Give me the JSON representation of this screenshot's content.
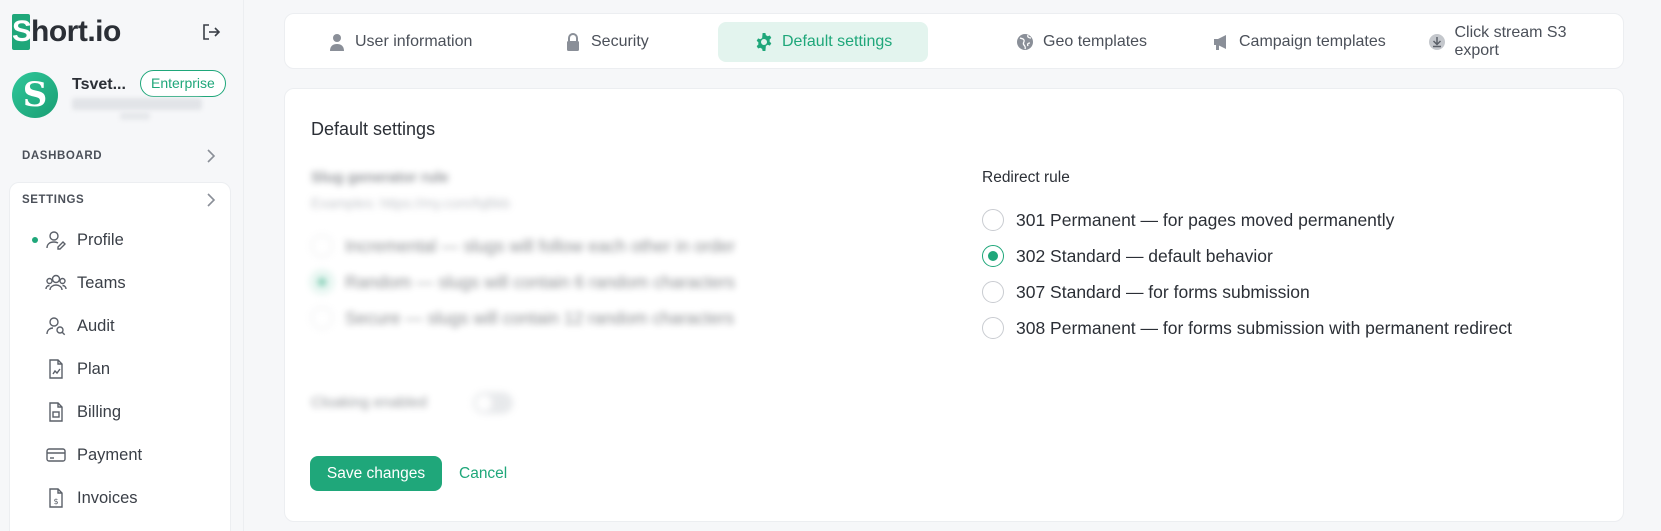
{
  "brand": {
    "logo_text": "hort.io",
    "logo_mark": "S"
  },
  "user": {
    "name": "Tsvet...",
    "plan": "Enterprise",
    "avatar_letter": "S"
  },
  "sidebar": {
    "dashboard_label": "DASHBOARD",
    "settings_label": "SETTINGS",
    "items": [
      {
        "label": "Profile",
        "icon": "user-edit-icon",
        "active": true
      },
      {
        "label": "Teams",
        "icon": "team-icon"
      },
      {
        "label": "Audit",
        "icon": "audit-icon"
      },
      {
        "label": "Plan",
        "icon": "plan-icon"
      },
      {
        "label": "Billing",
        "icon": "billing-icon"
      },
      {
        "label": "Payment",
        "icon": "card-icon"
      },
      {
        "label": "Invoices",
        "icon": "invoice-icon"
      }
    ]
  },
  "tabs": [
    {
      "label": "User information",
      "icon": "user-icon"
    },
    {
      "label": "Security",
      "icon": "lock-icon"
    },
    {
      "label": "Default settings",
      "icon": "gear-icon",
      "active": true
    },
    {
      "label": "Geo templates",
      "icon": "globe-icon"
    },
    {
      "label": "Campaign templates",
      "icon": "megaphone-icon"
    },
    {
      "label": "Click stream S3 export",
      "icon": "download-icon"
    }
  ],
  "content": {
    "title": "Default settings",
    "slug": {
      "label": "Slug generator rule",
      "example": "Examples: https://my.com/fqBkb",
      "options": [
        "Incremental — slugs will follow each other in order",
        "Random — slugs will contain 6 random characters",
        "Secure — slugs will contain 12 random characters"
      ],
      "selected": 1
    },
    "cloaking_label": "Cloaking enabled",
    "redirect": {
      "label": "Redirect rule",
      "options": [
        "301 Permanent — for pages moved permanently",
        "302 Standard — default behavior",
        "307 Standard — for forms submission",
        "308 Permanent — for forms submission with permanent redirect"
      ],
      "selected": 1
    },
    "save_label": "Save changes",
    "cancel_label": "Cancel"
  },
  "colors": {
    "accent": "#1fa77a",
    "accent_light": "#e3f4ee",
    "background": "#f6f7f9"
  }
}
